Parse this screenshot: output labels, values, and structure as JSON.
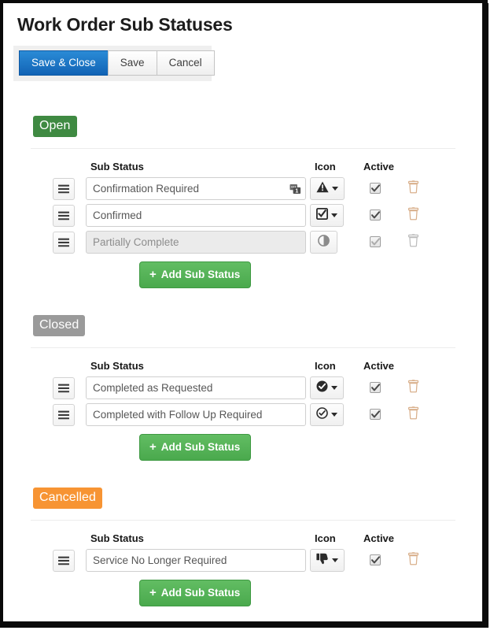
{
  "window": {
    "title": "Work Order Sub Statuses"
  },
  "toolbar": {
    "save_close_label": "Save & Close",
    "save_label": "Save",
    "cancel_label": "Cancel"
  },
  "columns": {
    "sub_status": "Sub Status",
    "icon": "Icon",
    "active": "Active"
  },
  "add_button_label": "+ Add Sub Status",
  "add_button_plus": "+",
  "add_button_text": "Add Sub Status",
  "colors": {
    "open_badge": "#3f8a42",
    "closed_badge": "#9a9a9a",
    "cancelled_badge": "#f79433",
    "primary_button": "#1263b5",
    "add_button": "#4aa94d",
    "delete_icon_active": "#d9b08c",
    "delete_icon_disabled": "#bdbdbd"
  },
  "sections": [
    {
      "id": "open",
      "badge_label": "Open",
      "badge_style": "badge-open",
      "rows": [
        {
          "name": "Confirmation Required",
          "icon": "warning-triangle-icon",
          "has_caret": true,
          "has_note_badge": true,
          "note_badge_icon": "note-count-icon",
          "note_count": "1",
          "active": true,
          "disabled": false
        },
        {
          "name": "Confirmed",
          "icon": "checkbox-checked-icon",
          "has_caret": true,
          "has_note_badge": false,
          "active": true,
          "disabled": false
        },
        {
          "name": "Partially Complete",
          "icon": "half-circle-icon",
          "has_caret": false,
          "has_note_badge": false,
          "active": true,
          "disabled": true
        }
      ]
    },
    {
      "id": "closed",
      "badge_label": "Closed",
      "badge_style": "badge-closed",
      "rows": [
        {
          "name": "Completed as Requested",
          "icon": "check-circle-filled-icon",
          "has_caret": true,
          "has_note_badge": false,
          "active": true,
          "disabled": false
        },
        {
          "name": "Completed with Follow Up Required",
          "icon": "check-circle-outline-icon",
          "has_caret": true,
          "has_note_badge": false,
          "active": true,
          "disabled": false
        }
      ]
    },
    {
      "id": "cancelled",
      "badge_label": "Cancelled",
      "badge_style": "badge-cancelled",
      "rows": [
        {
          "name": "Service No Longer Required",
          "icon": "thumbs-down-icon",
          "has_caret": true,
          "has_note_badge": false,
          "active": true,
          "disabled": false
        }
      ]
    }
  ]
}
